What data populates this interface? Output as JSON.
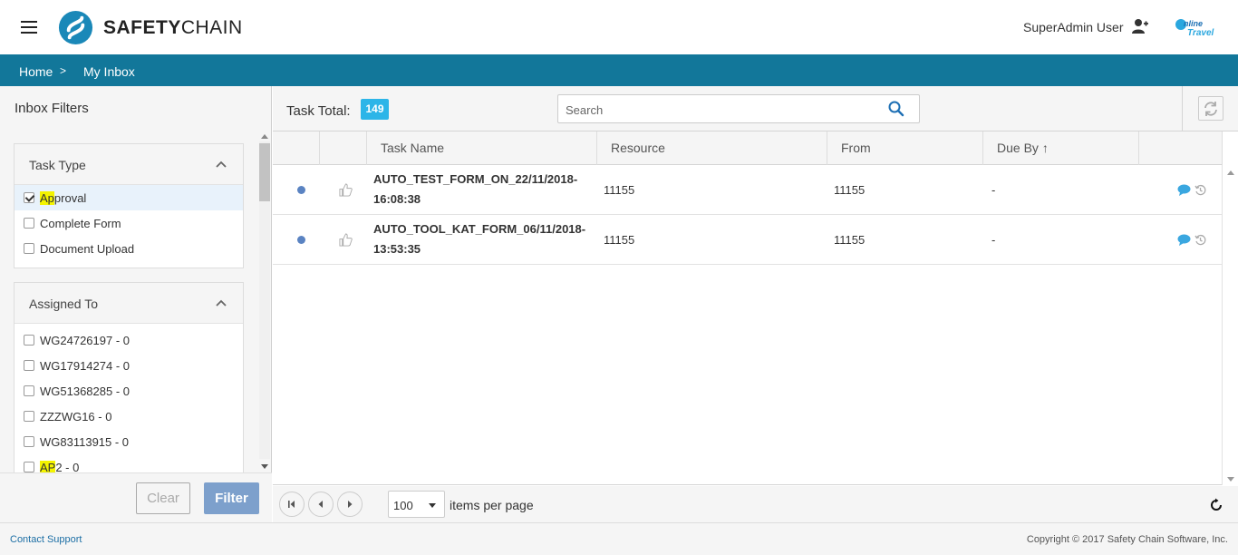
{
  "header": {
    "logo_bold": "SAFETY",
    "logo_light": "CHAIN",
    "user_name": "SuperAdmin User",
    "brand_badge_text": "Online Travel"
  },
  "breadcrumb": {
    "home": "Home",
    "separator": ">",
    "current": "My Inbox"
  },
  "filters": {
    "title": "Inbox Filters",
    "task_type": {
      "title": "Task Type",
      "options": [
        {
          "hl": "Ap",
          "rest": "proval",
          "checked": true
        },
        {
          "hl": "",
          "rest": "Complete Form",
          "checked": false
        },
        {
          "hl": "",
          "rest": "Document Upload",
          "checked": false
        }
      ]
    },
    "assigned_to": {
      "title": "Assigned To",
      "options": [
        {
          "hl": "",
          "rest": "WG24726197 - 0"
        },
        {
          "hl": "",
          "rest": "WG17914274 - 0"
        },
        {
          "hl": "",
          "rest": "WG51368285 - 0"
        },
        {
          "hl": "",
          "rest": "ZZZWG16 - 0"
        },
        {
          "hl": "",
          "rest": "WG83113915 - 0"
        },
        {
          "hl": "AP",
          "rest": "2 - 0"
        }
      ]
    },
    "clear_label": "Clear",
    "filter_label": "Filter"
  },
  "toolbar": {
    "task_total_label": "Task Total:",
    "task_total": "149",
    "search_placeholder": "Search"
  },
  "grid": {
    "columns": [
      "Task Name",
      "Resource",
      "From",
      "Due By"
    ],
    "sort_indicator": "↑",
    "rows": [
      {
        "task_line1": "AUTO_TEST_FORM_ON_22/11/2018-",
        "task_line2": "16:08:38",
        "resource": "11155",
        "from": "11155",
        "due_by": "-"
      },
      {
        "task_line1": "AUTO_TOOL_KAT_FORM_06/11/2018-",
        "task_line2": "13:53:35",
        "resource": "11155",
        "from": "11155",
        "due_by": "-"
      }
    ]
  },
  "pager": {
    "page_size": "100",
    "items_per_page_label": "items per page"
  },
  "footer": {
    "contact": "Contact Support",
    "copyright": "Copyright © 2017 Safety Chain Software, Inc."
  },
  "colors": {
    "brand_bar": "#12779a",
    "badge": "#2cb5e8",
    "filter_button": "#7da0cc",
    "unread_dot": "#5a83c2"
  }
}
